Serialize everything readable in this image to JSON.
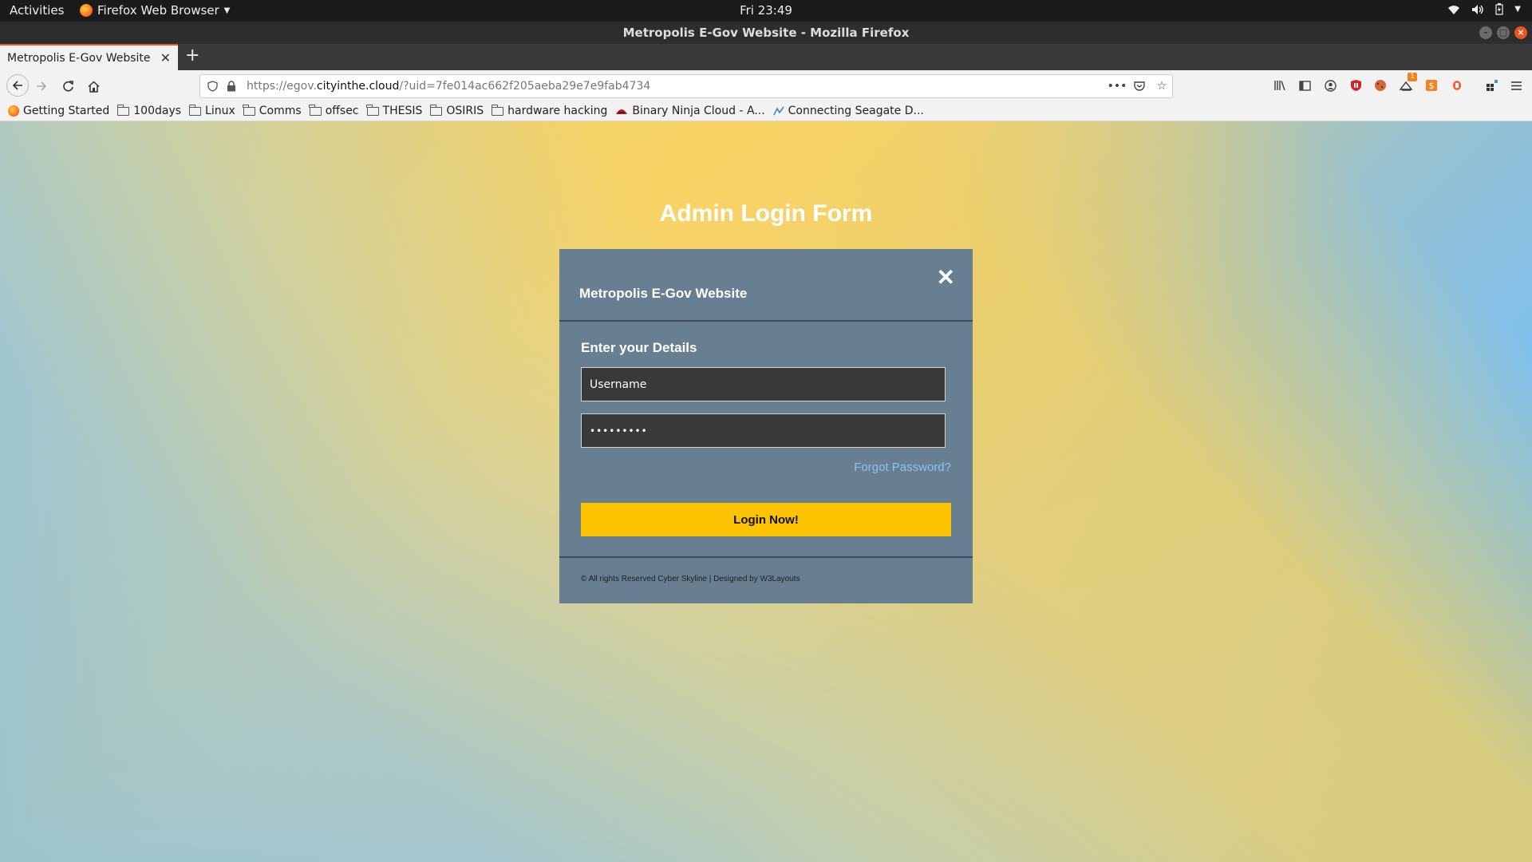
{
  "desktop": {
    "activities": "Activities",
    "app_name": "Firefox Web Browser",
    "clock": "Fri 23:49"
  },
  "window": {
    "title": "Metropolis E-Gov Website - Mozilla Firefox"
  },
  "tab": {
    "title": "Metropolis E-Gov Website"
  },
  "urlbar": {
    "url_prefix": "https://egov.",
    "url_domain": "cityinthe.cloud",
    "url_path": "/?uid=7fe014ac662f205aeba29e7e9fab4734"
  },
  "toolbar_badge": "1",
  "bookmarks": [
    {
      "label": "Getting Started",
      "icon": "firefox-icon"
    },
    {
      "label": "100days",
      "icon": "folder-icon"
    },
    {
      "label": "Linux",
      "icon": "folder-icon"
    },
    {
      "label": "Comms",
      "icon": "folder-icon"
    },
    {
      "label": "offsec",
      "icon": "folder-icon"
    },
    {
      "label": "THESIS",
      "icon": "folder-icon"
    },
    {
      "label": "OSIRIS",
      "icon": "folder-icon"
    },
    {
      "label": "hardware hacking",
      "icon": "folder-icon"
    },
    {
      "label": "Binary Ninja Cloud - A...",
      "icon": "binja-icon"
    },
    {
      "label": "Connecting Seagate D...",
      "icon": "seagate-icon"
    }
  ],
  "page": {
    "heading": "Admin Login Form",
    "card_title": "Metropolis E-Gov Website",
    "close_symbol": "✕",
    "details_heading": "Enter your Details",
    "username_value": "Username",
    "password_value": "•••••••••",
    "forgot_link": "Forgot Password?",
    "login_button": "Login Now!",
    "footer": "© All rights Reserved Cyber Skyline | Designed by W3Layouts"
  },
  "colors": {
    "card_bg": "#677f91",
    "button_bg": "#fcc300",
    "link": "#8cc3ef",
    "accent": "#e95420"
  }
}
